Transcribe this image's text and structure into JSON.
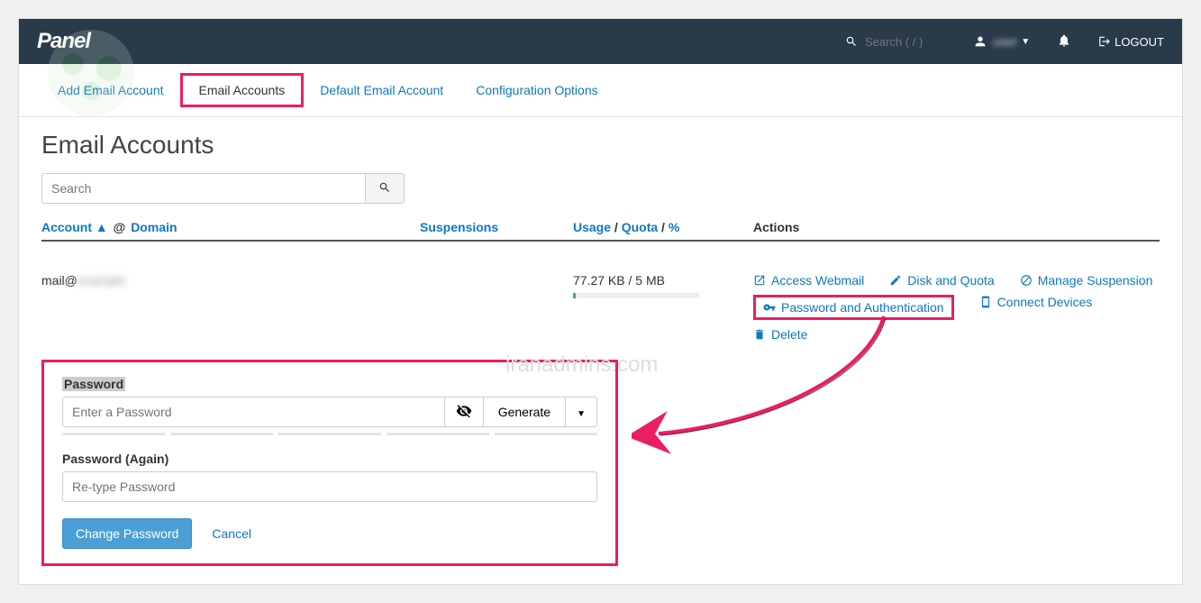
{
  "header": {
    "brand": "Panel",
    "search_placeholder": "Search ( / )",
    "user_name": "user",
    "logout_label": "LOGOUT"
  },
  "subnav": {
    "items": [
      {
        "label": "Add Email Account"
      },
      {
        "label": "Email Accounts"
      },
      {
        "label": "Default Email Account"
      },
      {
        "label": "Configuration Options"
      }
    ]
  },
  "page": {
    "title": "Email Accounts",
    "search_placeholder": "Search",
    "columns": {
      "account": "Account",
      "sort_arrow": "▲",
      "at": "@",
      "domain": "Domain",
      "suspensions": "Suspensions",
      "usage": "Usage",
      "quota": "Quota",
      "percent": "%",
      "actions": "Actions"
    }
  },
  "row": {
    "email_prefix": "mail@",
    "email_domain": "example",
    "usage": "77.27 KB / 5 MB",
    "actions": {
      "webmail": "Access Webmail",
      "disk": "Disk and Quota",
      "manage": "Manage Suspension",
      "password": "Password and Authentication",
      "connect": "Connect Devices",
      "delete": "Delete"
    }
  },
  "password_panel": {
    "label": "Password",
    "placeholder": "Enter a Password",
    "generate": "Generate",
    "label_again": "Password (Again)",
    "placeholder_again": "Re-type Password",
    "change_btn": "Change Password",
    "cancel": "Cancel"
  },
  "watermark": "iranadmins.com"
}
